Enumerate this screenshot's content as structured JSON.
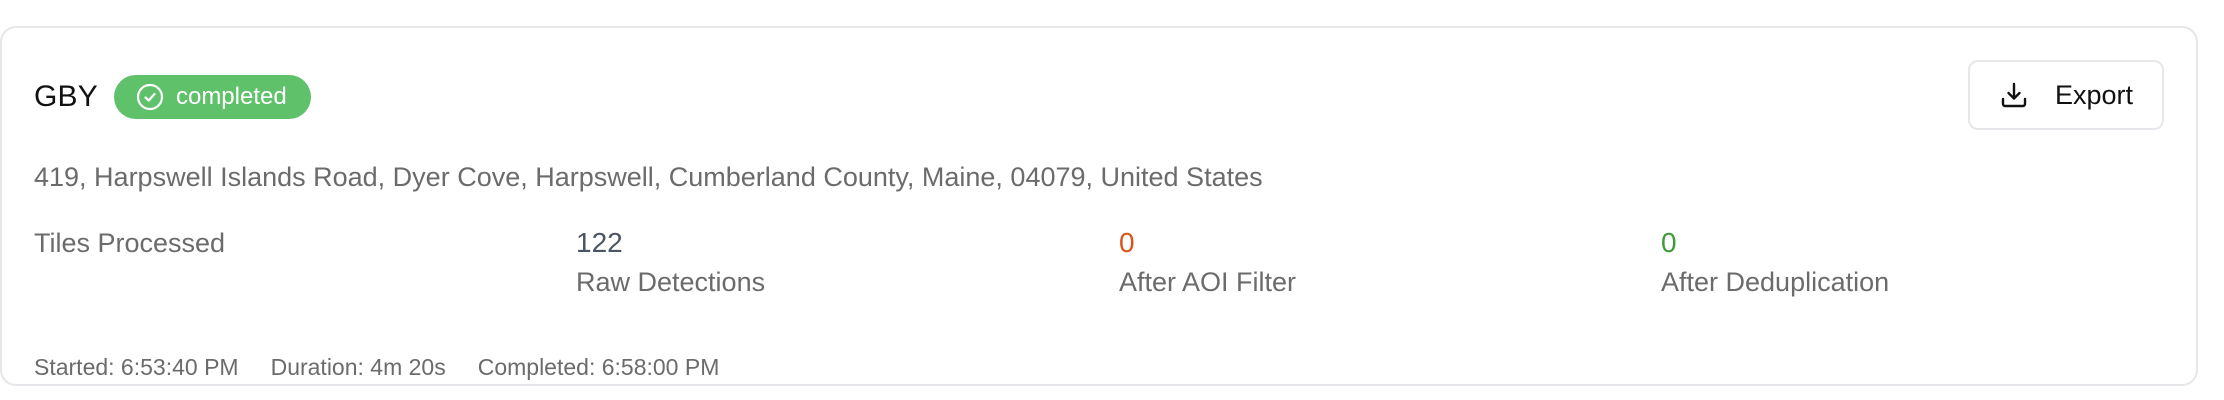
{
  "job": {
    "title": "GBY",
    "status": "completed",
    "status_color": "#5fc16a",
    "status_icon": "check-circle-icon"
  },
  "toolbar": {
    "export_label": "Export",
    "export_icon": "download-icon"
  },
  "location": {
    "address": "419, Harpswell Islands Road, Dyer Cove, Harpswell, Cumberland County, Maine, 04079, United States"
  },
  "stats": {
    "tiles": {
      "label": "Tiles Processed",
      "value": ""
    },
    "raw": {
      "label": "Raw Detections",
      "value": "122"
    },
    "aoi": {
      "label": "After AOI Filter",
      "value": "0",
      "color": "#d9541a"
    },
    "dedup": {
      "label": "After Deduplication",
      "value": "0",
      "color": "#3f9b38"
    }
  },
  "timing": {
    "started": "Started: 6:53:40 PM",
    "duration": "Duration: 4m 20s",
    "completed": "Completed: 6:58:00 PM"
  }
}
